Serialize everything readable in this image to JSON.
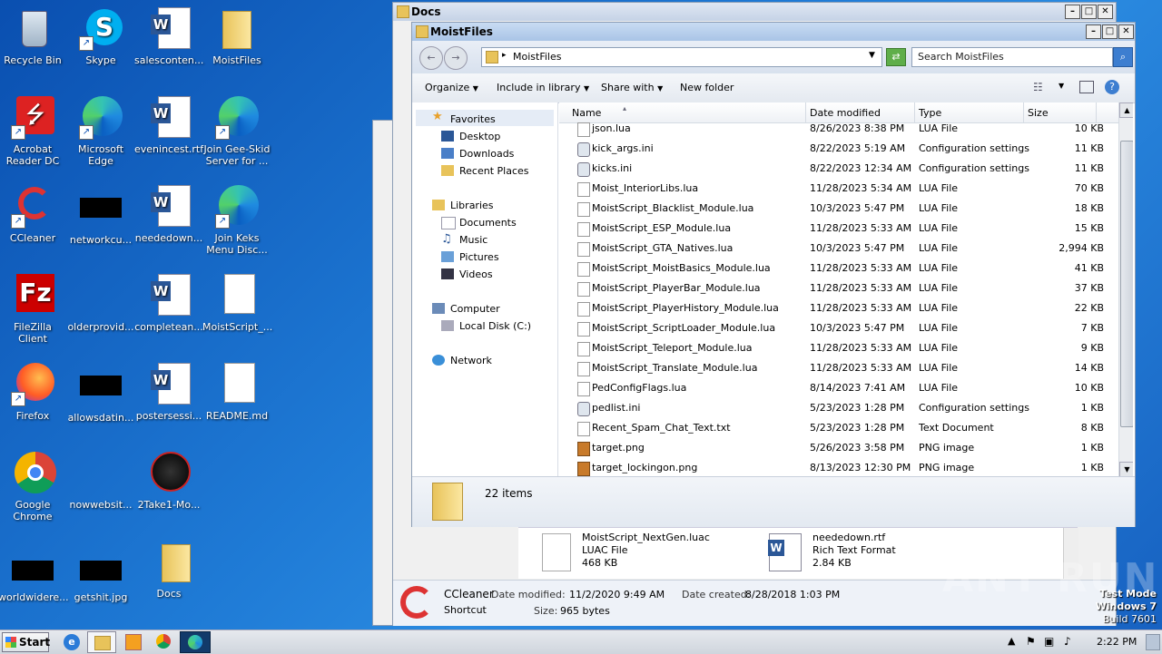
{
  "desktop": {
    "icons": [
      {
        "label": "Recycle Bin"
      },
      {
        "label": "Skype"
      },
      {
        "label": "salesconten..."
      },
      {
        "label": "MoistFiles"
      },
      {
        "label": "Acrobat Reader DC"
      },
      {
        "label": "Microsoft Edge"
      },
      {
        "label": "evenincest.rtf"
      },
      {
        "label": "Join Gee-Skid Server for ..."
      },
      {
        "label": "CCleaner"
      },
      {
        "label": "networkcu..."
      },
      {
        "label": "neededown..."
      },
      {
        "label": "Join Keks Menu Disc..."
      },
      {
        "label": "FileZilla Client"
      },
      {
        "label": "olderprovid..."
      },
      {
        "label": "completean..."
      },
      {
        "label": "MoistScript_..."
      },
      {
        "label": "Firefox"
      },
      {
        "label": "allowsdatin..."
      },
      {
        "label": "postersessi..."
      },
      {
        "label": "README.md"
      },
      {
        "label": "Google Chrome"
      },
      {
        "label": "nowwebsit..."
      },
      {
        "label": "2Take1-Mo..."
      },
      {
        "label": "worldwidere..."
      },
      {
        "label": "getshit.jpg"
      },
      {
        "label": "Docs"
      }
    ]
  },
  "docs_window": {
    "title": "Docs",
    "files": [
      {
        "name": "MoistScript_NextGen.luac",
        "type": "LUAC File",
        "size": "468 KB"
      },
      {
        "name": "neededown.rtf",
        "type": "Rich Text Format",
        "size": "2.84 KB"
      }
    ],
    "details": {
      "name": "CCleaner",
      "kind": "Shortcut",
      "modified_label": "Date modified:",
      "modified": "11/2/2020 9:49 AM",
      "created_label": "Date created:",
      "created": "8/28/2018 1:03 PM",
      "size_label": "Size:",
      "size": "965 bytes"
    }
  },
  "explorer": {
    "title": "MoistFiles",
    "address": "MoistFiles",
    "search_placeholder": "Search MoistFiles",
    "toolbar": {
      "organize": "Organize",
      "include": "Include in library",
      "share": "Share with",
      "new_folder": "New folder"
    },
    "columns": {
      "name": "Name",
      "date": "Date modified",
      "type": "Type",
      "size": "Size"
    },
    "nav": {
      "favorites": "Favorites",
      "desktop": "Desktop",
      "downloads": "Downloads",
      "recent": "Recent Places",
      "libraries": "Libraries",
      "documents": "Documents",
      "music": "Music",
      "pictures": "Pictures",
      "videos": "Videos",
      "computer": "Computer",
      "local_disk": "Local Disk (C:)",
      "network": "Network"
    },
    "files": [
      {
        "name": "json.lua",
        "date": "8/26/2023 8:38 PM",
        "type": "LUA File",
        "size": "10 KB",
        "kind": "doc"
      },
      {
        "name": "kick_args.ini",
        "date": "8/22/2023 5:19 AM",
        "type": "Configuration settings",
        "size": "11 KB",
        "kind": "ini"
      },
      {
        "name": "kicks.ini",
        "date": "8/22/2023 12:34 AM",
        "type": "Configuration settings",
        "size": "11 KB",
        "kind": "ini"
      },
      {
        "name": "Moist_InteriorLibs.lua",
        "date": "11/28/2023 5:34 AM",
        "type": "LUA File",
        "size": "70 KB",
        "kind": "doc"
      },
      {
        "name": "MoistScript_Blacklist_Module.lua",
        "date": "10/3/2023 5:47 PM",
        "type": "LUA File",
        "size": "18 KB",
        "kind": "doc"
      },
      {
        "name": "MoistScript_ESP_Module.lua",
        "date": "11/28/2023 5:33 AM",
        "type": "LUA File",
        "size": "15 KB",
        "kind": "doc"
      },
      {
        "name": "MoistScript_GTA_Natives.lua",
        "date": "10/3/2023 5:47 PM",
        "type": "LUA File",
        "size": "2,994 KB",
        "kind": "doc"
      },
      {
        "name": "MoistScript_MoistBasics_Module.lua",
        "date": "11/28/2023 5:33 AM",
        "type": "LUA File",
        "size": "41 KB",
        "kind": "doc"
      },
      {
        "name": "MoistScript_PlayerBar_Module.lua",
        "date": "11/28/2023 5:33 AM",
        "type": "LUA File",
        "size": "37 KB",
        "kind": "doc"
      },
      {
        "name": "MoistScript_PlayerHistory_Module.lua",
        "date": "11/28/2023 5:33 AM",
        "type": "LUA File",
        "size": "22 KB",
        "kind": "doc"
      },
      {
        "name": "MoistScript_ScriptLoader_Module.lua",
        "date": "10/3/2023 5:47 PM",
        "type": "LUA File",
        "size": "7 KB",
        "kind": "doc"
      },
      {
        "name": "MoistScript_Teleport_Module.lua",
        "date": "11/28/2023 5:33 AM",
        "type": "LUA File",
        "size": "9 KB",
        "kind": "doc"
      },
      {
        "name": "MoistScript_Translate_Module.lua",
        "date": "11/28/2023 5:33 AM",
        "type": "LUA File",
        "size": "14 KB",
        "kind": "doc"
      },
      {
        "name": "PedConfigFlags.lua",
        "date": "8/14/2023 7:41 AM",
        "type": "LUA File",
        "size": "10 KB",
        "kind": "doc"
      },
      {
        "name": "pedlist.ini",
        "date": "5/23/2023 1:28 PM",
        "type": "Configuration settings",
        "size": "1 KB",
        "kind": "ini"
      },
      {
        "name": "Recent_Spam_Chat_Text.txt",
        "date": "5/23/2023 1:28 PM",
        "type": "Text Document",
        "size": "8 KB",
        "kind": "doc"
      },
      {
        "name": "target.png",
        "date": "5/26/2023 3:58 PM",
        "type": "PNG image",
        "size": "1 KB",
        "kind": "png"
      },
      {
        "name": "target_lockingon.png",
        "date": "8/13/2023 12:30 PM",
        "type": "PNG image",
        "size": "1 KB",
        "kind": "png"
      }
    ],
    "status": "22 items"
  },
  "taskbar": {
    "start": "Start",
    "time": "2:22 PM"
  },
  "watermark": {
    "line1": "Test Mode",
    "line2": "Windows 7",
    "line3": "Build 7601",
    "anyrun": "ANY RUN"
  }
}
